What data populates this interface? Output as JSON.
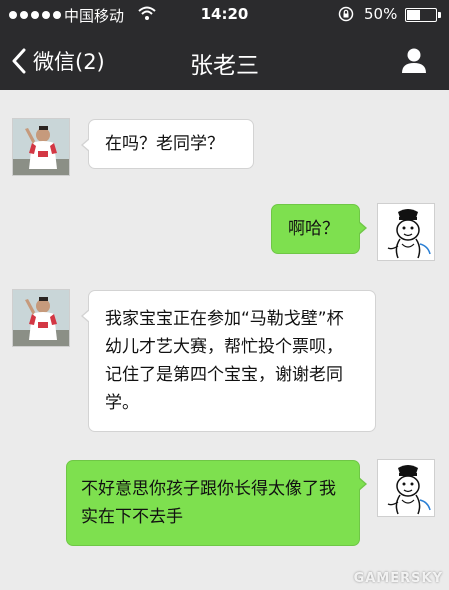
{
  "status_bar": {
    "carrier": "中国移动",
    "time": "14:20",
    "battery_percent": "50%",
    "battery_level": 0.5
  },
  "nav": {
    "back_label": "微信(2)",
    "title": "张老三"
  },
  "messages": [
    {
      "side": "incoming",
      "text": "在吗？老同学？"
    },
    {
      "side": "outgoing",
      "text": "啊哈？"
    },
    {
      "side": "incoming",
      "text": "我家宝宝正在参加“马勒戈壁”杯幼儿才艺大赛，帮忙投个票呗，记住了是第四个宝宝，谢谢老同学。"
    },
    {
      "side": "outgoing",
      "text": "不好意思你孩子跟你长得太像了我实在下不去手"
    }
  ],
  "watermark": "GAMERSKY",
  "colors": {
    "bar": "#2b2b2d",
    "chat_bg": "#ebebeb",
    "outgoing_bubble": "#7ee04f",
    "incoming_bubble": "#ffffff"
  }
}
